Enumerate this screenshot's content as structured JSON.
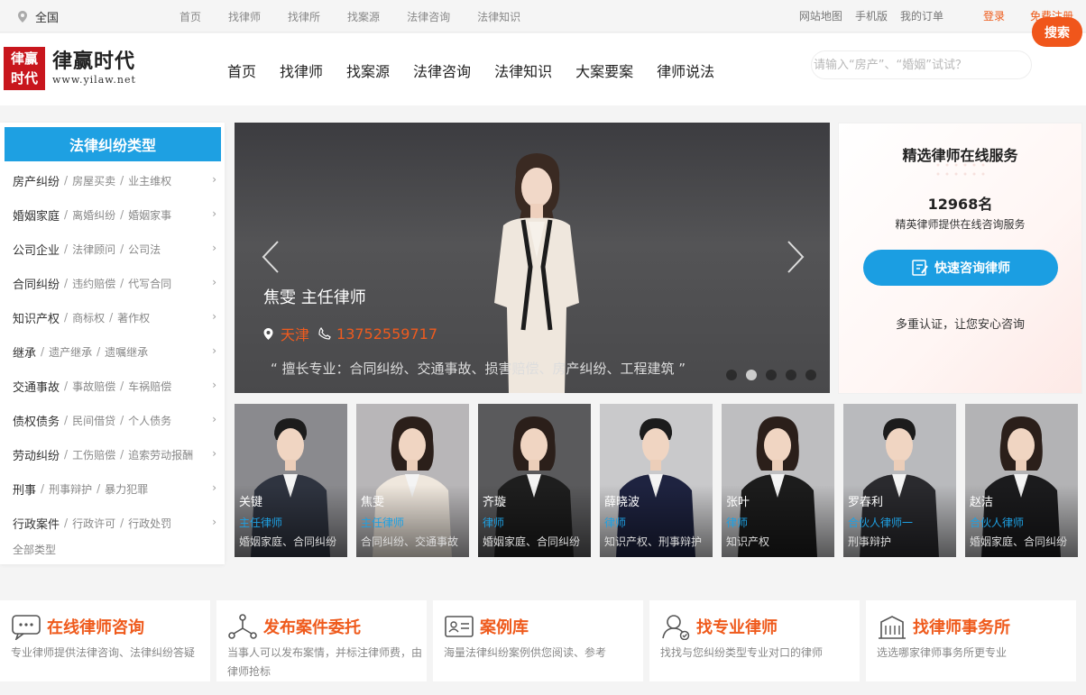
{
  "topbar": {
    "location": "全国",
    "nav": [
      "首页",
      "找律师",
      "找律所",
      "找案源",
      "法律咨询",
      "法律知识"
    ],
    "links": [
      "网站地图",
      "手机版",
      "我的订单"
    ],
    "login": "登录",
    "register": "免费注册"
  },
  "header": {
    "logo_text": "律赢时代",
    "logo_url": "www.yilaw.net",
    "nav": [
      "首页",
      "找律师",
      "找案源",
      "法律咨询",
      "法律知识",
      "大案要案",
      "律师说法"
    ],
    "search_placeholder": "请输入“房产”、“婚姻”试试？",
    "search_button": "搜索"
  },
  "sidebar": {
    "title": "法律纠纷类型",
    "categories": [
      {
        "main": "房产纠纷",
        "subs": [
          "房屋买卖",
          "业主维权"
        ]
      },
      {
        "main": "婚姻家庭",
        "subs": [
          "离婚纠纷",
          "婚姻家事"
        ]
      },
      {
        "main": "公司企业",
        "subs": [
          "法律顾问",
          "公司法"
        ]
      },
      {
        "main": "合同纠纷",
        "subs": [
          "违约赔偿",
          "代写合同"
        ]
      },
      {
        "main": "知识产权",
        "subs": [
          "商标权",
          "著作权"
        ]
      },
      {
        "main": "继承",
        "subs": [
          "遗产继承",
          "遗嘱继承"
        ]
      },
      {
        "main": "交通事故",
        "subs": [
          "事故赔偿",
          "车祸赔偿"
        ]
      },
      {
        "main": "债权债务",
        "subs": [
          "民间借贷",
          "个人债务"
        ]
      },
      {
        "main": "劳动纠纷",
        "subs": [
          "工伤赔偿",
          "追索劳动报酬"
        ]
      },
      {
        "main": "刑事",
        "subs": [
          "刑事辩护",
          "暴力犯罪"
        ]
      },
      {
        "main": "行政案件",
        "subs": [
          "行政许可",
          "行政处罚"
        ]
      }
    ],
    "all": "全部类型"
  },
  "banner": {
    "name": "焦雯 主任律师",
    "city": "天津",
    "phone": "13752559717",
    "description": "“ 擅长专业：合同纠纷、交通事故、损害赔偿、房产纠纷、工程建筑 ”",
    "slide_count": 5,
    "active_slide": 2
  },
  "panel": {
    "title": "精选律师在线服务",
    "count": "12968名",
    "desc": "精英律师提供在线咨询服务",
    "button": "快速咨询律师",
    "note": "多重认证，让您安心咨询"
  },
  "lawyers": [
    {
      "name": "关键",
      "title": "主任律师",
      "spec": "婚姻家庭、合同纠纷",
      "gender": "m",
      "bg": "#8a8a8e"
    },
    {
      "name": "焦雯",
      "title": "主任律师",
      "spec": "合同纠纷、交通事故",
      "gender": "f",
      "bg": "#b8b6b8"
    },
    {
      "name": "齐璇",
      "title": "律师",
      "spec": "婚姻家庭、合同纠纷",
      "gender": "f2",
      "bg": "#5a5a5c"
    },
    {
      "name": "薛晓波",
      "title": "律师",
      "spec": "知识产权、刑事辩护",
      "gender": "m2",
      "bg": "#c9c9cb"
    },
    {
      "name": "张叶",
      "title": "律师",
      "spec": "知识产权",
      "gender": "f3",
      "bg": "#bebec0"
    },
    {
      "name": "罗春利",
      "title": "合伙人律师一",
      "spec": "刑事辩护",
      "gender": "m3",
      "bg": "#b9babd"
    },
    {
      "name": "赵洁",
      "title": "合伙人律师",
      "spec": "婚姻家庭、合同纠纷",
      "gender": "f4",
      "bg": "#b3b3b5"
    }
  ],
  "features": [
    {
      "title": "在线律师咨询",
      "desc": "专业律师提供法律咨询、法律纠纷答疑",
      "icon": "chat-icon"
    },
    {
      "title": "发布案件委托",
      "desc": "当事人可以发布案情，并标注律师费，由律师抢标",
      "icon": "share-icon"
    },
    {
      "title": "案例库",
      "desc": "海量法律纠纷案例供您阅读、参考",
      "icon": "id-card-icon"
    },
    {
      "title": "找专业律师",
      "desc": "找找与您纠纷类型专业对口的律师",
      "icon": "lawyer-icon"
    },
    {
      "title": "找律师事务所",
      "desc": "选选哪家律师事务所更专业",
      "icon": "building-icon"
    }
  ],
  "colors": {
    "brand_blue": "#1ea0e2",
    "brand_orange": "#ef5a1c",
    "logo_red": "#c8161d"
  }
}
